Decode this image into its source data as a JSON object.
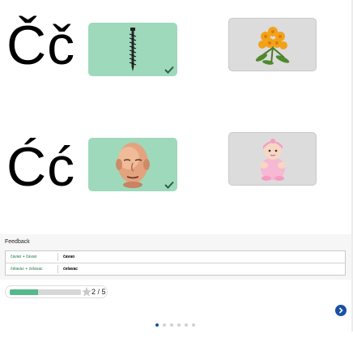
{
  "exercise": {
    "rows": [
      {
        "letters": "Čč",
        "answered_image": "screw-icon",
        "target_image": "flower-icon",
        "correct": true
      },
      {
        "letters": "Ćć",
        "answered_image": "face-icon",
        "target_image": "baby-icon",
        "correct": true
      }
    ]
  },
  "feedback": {
    "title": "Feedback",
    "rows": [
      {
        "given": "čavao",
        "plus": "+",
        "expected_given": "čavao",
        "answer": "čavao"
      },
      {
        "given": "ćelavac",
        "plus": "+",
        "expected_given": "ćelavac",
        "answer": "ćelavac"
      }
    ]
  },
  "progress": {
    "text": "2 / 5",
    "completed": 2,
    "total": 5,
    "fraction": 0.4
  },
  "pagination": {
    "pages": 6,
    "active_index": 0
  },
  "colors": {
    "answered_card": "#9ed9bc",
    "target_card": "#dcdcdc",
    "progress_fill": "#55b98b",
    "accent": "#1a4fa3"
  }
}
